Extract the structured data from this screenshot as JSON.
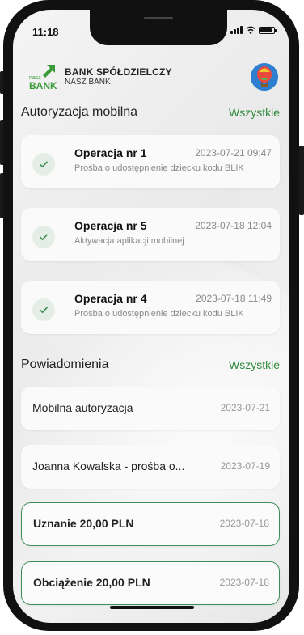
{
  "status_bar": {
    "time": "11:18"
  },
  "header": {
    "logo_text": {
      "small": "nasz",
      "big": "BANK"
    },
    "bank_name": "BANK SPÓŁDZIELCZY",
    "bank_subtitle": "NASZ BANK"
  },
  "authorizations": {
    "title": "Autoryzacja mobilna",
    "see_all": "Wszystkie",
    "items": [
      {
        "title": "Operacja nr 1",
        "date": "2023-07-21 09:47",
        "description": "Prośba o udostępnienie dziecku kodu BLIK"
      },
      {
        "title": "Operacja nr 5",
        "date": "2023-07-18 12:04",
        "description": "Aktywacja aplikacji mobilnej"
      },
      {
        "title": "Operacja nr 4",
        "date": "2023-07-18 11:49",
        "description": "Prośba o udostępnienie dziecku kodu BLIK"
      }
    ]
  },
  "notifications": {
    "title": "Powiadomienia",
    "see_all": "Wszystkie",
    "items": [
      {
        "title": "Mobilna autoryzacja",
        "date": "2023-07-21"
      },
      {
        "title": "Joanna Kowalska - prośba o...",
        "date": "2023-07-19"
      },
      {
        "title": "Uznanie 20,00 PLN",
        "date": "2023-07-18"
      },
      {
        "title": "Obciążenie 20,00 PLN",
        "date": "2023-07-18"
      }
    ]
  },
  "colors": {
    "accent_green": "#2e8a3c",
    "outline_green": "#3e8f57"
  },
  "icons": {
    "avatar": "hot-air-balloon-avatar",
    "check": "check-icon"
  }
}
